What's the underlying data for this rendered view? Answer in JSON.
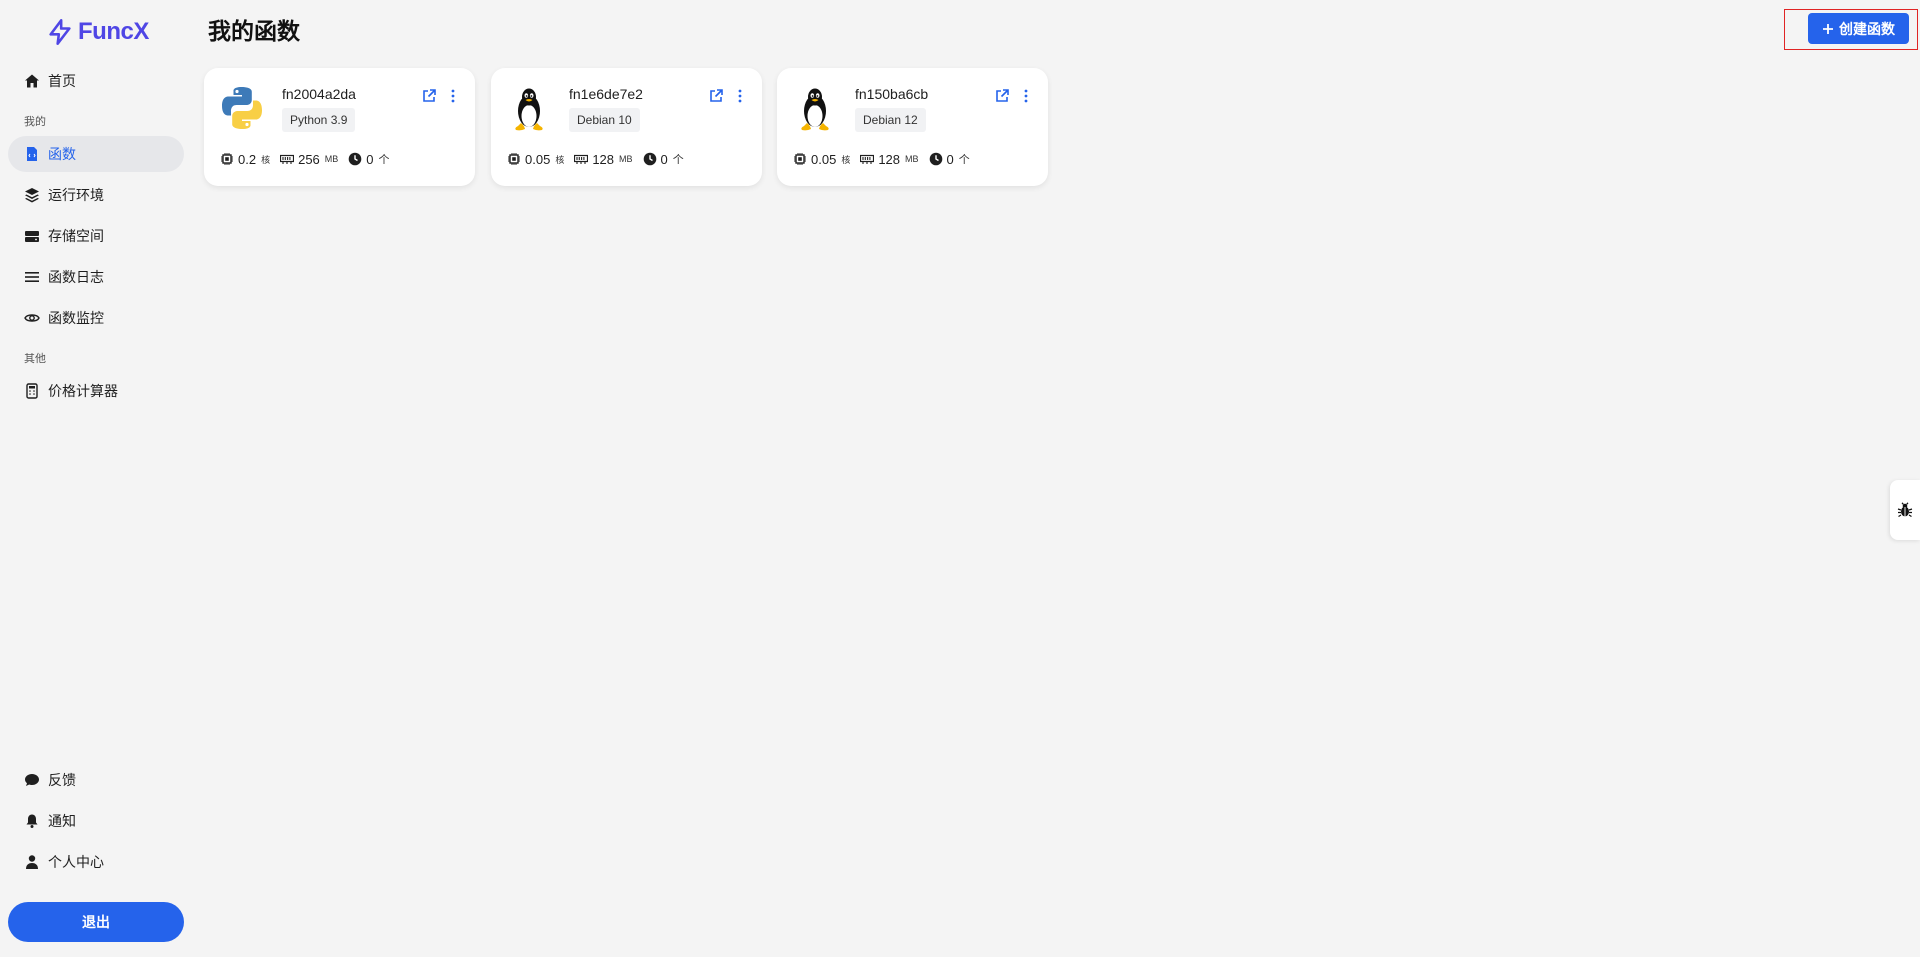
{
  "app": {
    "name": "FuncX"
  },
  "sidebar": {
    "home": "首页",
    "section_mine": "我的",
    "items": [
      {
        "label": "函数",
        "icon": "file-code-icon",
        "active": true
      },
      {
        "label": "运行环境",
        "icon": "layers-icon"
      },
      {
        "label": "存储空间",
        "icon": "hard-drive-icon"
      },
      {
        "label": "函数日志",
        "icon": "list-icon"
      },
      {
        "label": "函数监控",
        "icon": "eye-icon"
      }
    ],
    "section_other": "其他",
    "other_items": [
      {
        "label": "价格计算器",
        "icon": "calculator-icon"
      }
    ],
    "bottom_items": [
      {
        "label": "反馈",
        "icon": "comment-icon"
      },
      {
        "label": "通知",
        "icon": "bell-icon"
      },
      {
        "label": "个人中心",
        "icon": "user-icon"
      }
    ],
    "logout": "退出"
  },
  "header": {
    "title": "我的函数",
    "create_button": "创建函数"
  },
  "functions": [
    {
      "name": "fn2004a2da",
      "runtime": "Python 3.9",
      "runtime_icon": "python-logo",
      "cpu": "0.2",
      "cpu_unit": "核",
      "memory": "256",
      "memory_unit": "MB",
      "instances": "0",
      "instances_unit": "个"
    },
    {
      "name": "fn1e6de7e2",
      "runtime": "Debian 10",
      "runtime_icon": "linux-tux-logo",
      "cpu": "0.05",
      "cpu_unit": "核",
      "memory": "128",
      "memory_unit": "MB",
      "instances": "0",
      "instances_unit": "个"
    },
    {
      "name": "fn150ba6cb",
      "runtime": "Debian 12",
      "runtime_icon": "linux-tux-logo",
      "cpu": "0.05",
      "cpu_unit": "核",
      "memory": "128",
      "memory_unit": "MB",
      "instances": "0",
      "instances_unit": "个"
    }
  ],
  "colors": {
    "accent": "#2563eb",
    "brand": "#4f46e5",
    "highlight_border": "#e02424"
  }
}
